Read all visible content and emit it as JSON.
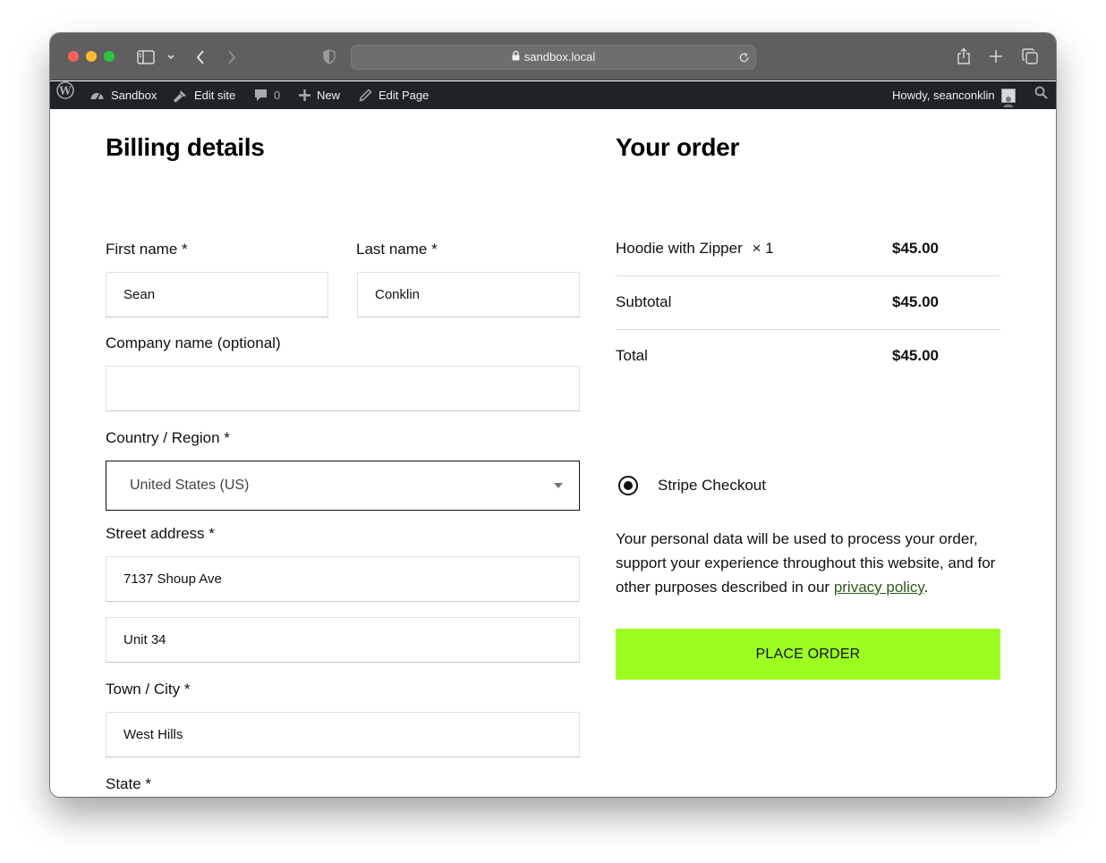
{
  "browser": {
    "url": "sandbox.local",
    "icons": [
      "sidebar-icon",
      "chevron-down-icon",
      "back-icon",
      "forward-icon",
      "shield-icon",
      "lock-icon",
      "reload-icon",
      "share-icon",
      "new-tab-icon",
      "tabs-overview-icon"
    ]
  },
  "adminbar": {
    "site_name": "Sandbox",
    "edit_site": "Edit site",
    "comments_count": "0",
    "new_label": "New",
    "edit_page": "Edit Page",
    "howdy": "Howdy, seanconklin"
  },
  "billing": {
    "title": "Billing details",
    "first_name_label": "First name *",
    "first_name_value": "Sean",
    "last_name_label": "Last name *",
    "last_name_value": "Conklin",
    "company_label": "Company name (optional)",
    "company_value": "",
    "country_label": "Country / Region *",
    "country_value": "United States (US)",
    "street_label": "Street address *",
    "street_value_1": "7137 Shoup Ave",
    "street_value_2": "Unit 34",
    "city_label": "Town / City *",
    "city_value": "West Hills",
    "state_label": "State *"
  },
  "order": {
    "title": "Your order",
    "item_name": "Hoodie with Zipper",
    "item_qty": "× 1",
    "item_price": "$45.00",
    "subtotal_label": "Subtotal",
    "subtotal_value": "$45.00",
    "total_label": "Total",
    "total_value": "$45.00",
    "payment_method": "Stripe Checkout",
    "privacy_text_before": "Your personal data will be used to process your order, support your experience throughout this website, and for other purposes described in our ",
    "privacy_link": "privacy policy",
    "privacy_text_after": ".",
    "place_order": "PLACE ORDER"
  },
  "colors": {
    "place_order_bg": "#9dff20",
    "admin_bar_bg": "#1d2327",
    "link_color": "#2b5a1a"
  }
}
